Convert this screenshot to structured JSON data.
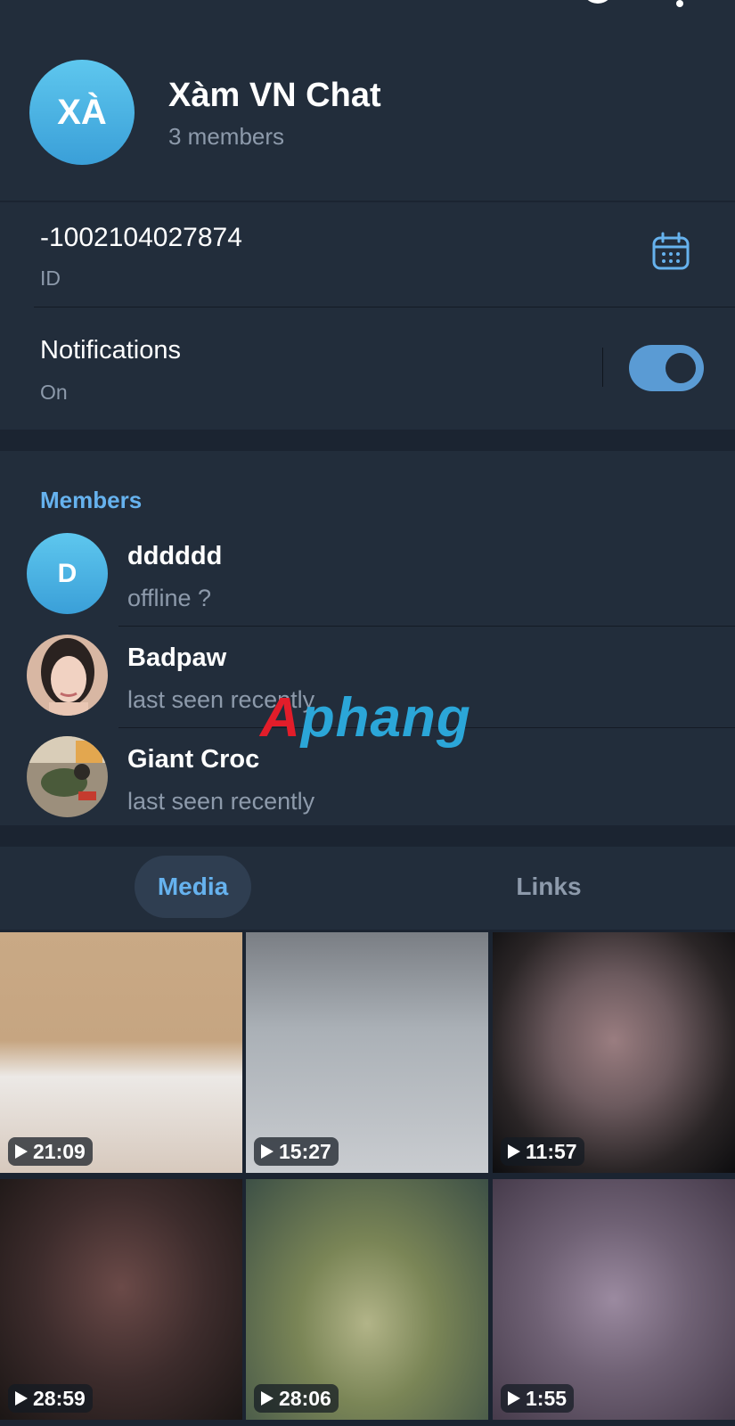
{
  "header": {
    "avatar_initials": "XÀ",
    "title": "Xàm VN Chat",
    "subtitle": "3 members",
    "avatar_color": "#4bb6e6"
  },
  "info": {
    "id_value": "-1002104027874",
    "id_label": "ID",
    "notifications_title": "Notifications",
    "notifications_state": "On",
    "notifications_enabled": true
  },
  "members": {
    "header": "Members",
    "items": [
      {
        "name": "dddddd",
        "status": "offline ?",
        "avatar_initial": "D"
      },
      {
        "name": "Badpaw",
        "status": "last seen recently"
      },
      {
        "name": "Giant Croc",
        "status": "last seen recently"
      }
    ]
  },
  "watermark": {
    "first": "A",
    "rest": "phang"
  },
  "tabs": [
    {
      "label": "Media",
      "active": true
    },
    {
      "label": "Links",
      "active": false
    }
  ],
  "media": [
    {
      "duration": "21:09"
    },
    {
      "duration": "15:27"
    },
    {
      "duration": "11:57"
    },
    {
      "duration": "28:59"
    },
    {
      "duration": "28:06"
    },
    {
      "duration": "1:55"
    }
  ],
  "colors": {
    "accent": "#66b2ee",
    "background": "#1b2431",
    "panel": "#222d3b",
    "muted_text": "#8d9aab"
  }
}
